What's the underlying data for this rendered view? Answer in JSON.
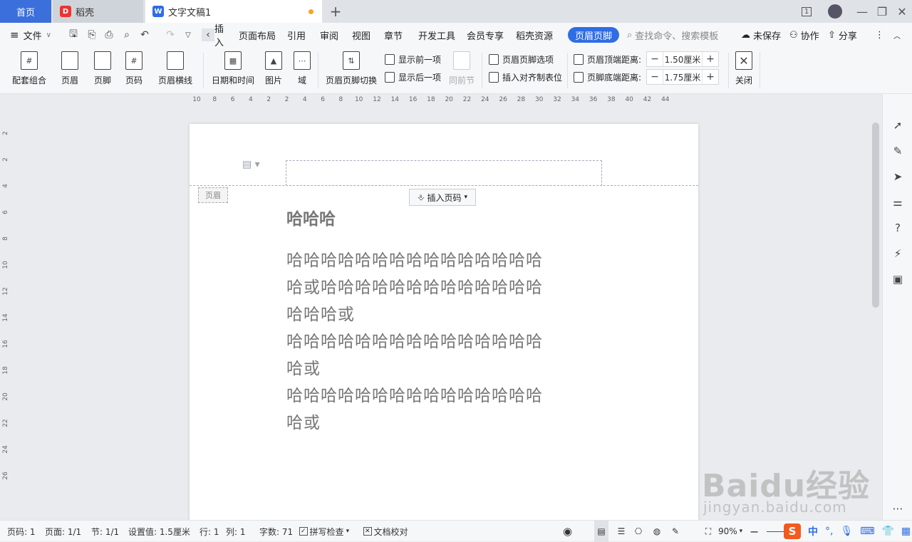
{
  "titlebar": {
    "tabs": [
      {
        "label": "首页"
      },
      {
        "label": "稻壳"
      },
      {
        "label": "文字文稿1"
      }
    ],
    "add_tab": "+",
    "window_counter": "1"
  },
  "menubar": {
    "file": "文件",
    "items": [
      "插入",
      "页面布局",
      "引用",
      "审阅",
      "视图",
      "章节",
      "开发工具",
      "会员专享",
      "稻壳资源",
      "页眉页脚"
    ],
    "search_placeholder": "查找命令、搜索模板",
    "unsaved": "未保存",
    "collab": "协作",
    "share": "分享"
  },
  "ribbon": {
    "buttons": [
      "配套组合",
      "页眉",
      "页脚",
      "页码",
      "页眉横线",
      "日期和时间",
      "图片",
      "域",
      "页眉页脚切换"
    ],
    "show_prev": "显示前一项",
    "show_next": "显示后一项",
    "same_as_prev": "同前节",
    "hf_options": "页眉页脚选项",
    "insert_align_tab": "插入对齐制表位",
    "header_top_label": "页眉顶端距离:",
    "header_top_value": "1.50厘米",
    "footer_bottom_label": "页脚底端距离:",
    "footer_bottom_value": "1.75厘米",
    "close": "关闭"
  },
  "ruler": {
    "h_ticks": [
      "10",
      "8",
      "6",
      "4",
      "2",
      "2",
      "4",
      "6",
      "8",
      "10",
      "12",
      "14",
      "16",
      "18",
      "20",
      "22",
      "24",
      "26",
      "28",
      "30",
      "32",
      "34",
      "36",
      "38",
      "40",
      "42",
      "44"
    ],
    "v_ticks": [
      "2",
      "2",
      "4",
      "6",
      "8",
      "10",
      "12",
      "14",
      "16",
      "18",
      "20",
      "22",
      "24",
      "26"
    ]
  },
  "page": {
    "header_tag": "页眉",
    "insert_page_number": "插入页码",
    "title": "哈哈哈",
    "lines": [
      "哈哈哈哈哈哈哈哈哈哈哈哈哈哈哈",
      "哈或哈哈哈哈哈哈哈哈哈哈哈哈哈",
      "哈哈哈或",
      "哈哈哈哈哈哈哈哈哈哈哈哈哈哈哈",
      "哈或",
      "哈哈哈哈哈哈哈哈哈哈哈哈哈哈哈",
      "哈或"
    ]
  },
  "statusbar": {
    "page_num": "页码: 1",
    "pages": "页面: 1/1",
    "section": "节: 1/1",
    "setting": "设置值: 1.5厘米",
    "row": "行: 1",
    "col": "列: 1",
    "words": "字数: 71",
    "spell": "拼写检查",
    "proof": "文档校对",
    "zoom": "90%"
  },
  "watermark": {
    "main": "Baidu经验",
    "sub": "jingyan.baidu.com"
  },
  "ime": {
    "logo": "S",
    "lang": "中"
  },
  "colors": {
    "accent": "#2f6de5",
    "titlebar_bg": "#dfe3e8",
    "ribbon_bg": "#f6f7f9"
  }
}
